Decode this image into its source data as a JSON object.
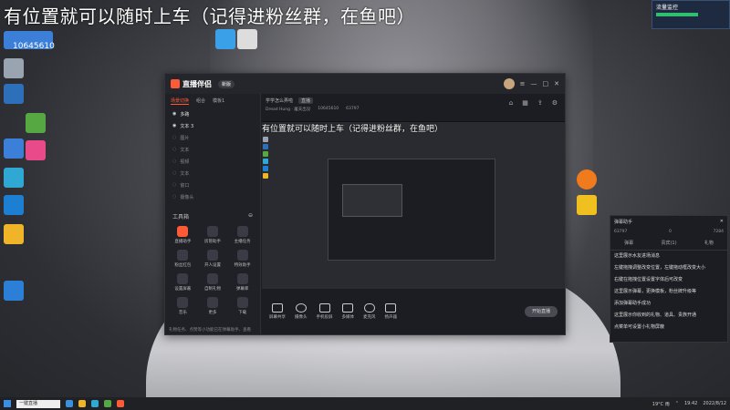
{
  "overlay": {
    "title": "有位置就可以随时上车（记得进粉丝群，在鱼吧）",
    "user_id": "10645610"
  },
  "desktop_icons": [
    {
      "name": "recycle-bin",
      "label": "回收站",
      "color": "#9aa3b0"
    },
    {
      "name": "app-2",
      "label": "",
      "color": "#2d6fb8"
    },
    {
      "name": "app-3",
      "label": "",
      "color": "#3b7fd8"
    },
    {
      "name": "app-4",
      "label": "",
      "color": "#56a843"
    },
    {
      "name": "app-5",
      "label": "",
      "color": "#2fa8d4"
    },
    {
      "name": "app-6",
      "label": "",
      "color": "#1c7fd1"
    },
    {
      "name": "app-7",
      "label": "",
      "color": "#f0b429"
    },
    {
      "name": "app-8",
      "label": "",
      "color": "#2c7fd6"
    }
  ],
  "app": {
    "name": "直播伴侣",
    "version": "新版",
    "left_tabs": [
      "场景切换",
      "组合",
      "模板1"
    ],
    "scenes": [
      "多路",
      "文本 3",
      "图片",
      "文本",
      "视频",
      "文本",
      "窗口",
      "摄像头"
    ],
    "tools_title": "工具箱",
    "tools": [
      "直播助手",
      "房管助手",
      "主播任务",
      "粉丝红包",
      "开人设置",
      "特效助手",
      "设置屏蔽",
      "自制礼物",
      "弹幕库",
      "音乐",
      "更多",
      "下载"
    ],
    "footer": "礼物任务、点赞等小功能已在弹幕助手、查看",
    "center_title": "学学怎么弄啦",
    "center_tag": "直播",
    "center_info": [
      "Dread Hung · 屠夫出没",
      "10645610",
      "63797"
    ],
    "bottom_items": [
      "屏幕共享",
      "摄像头",
      "手机投屏",
      "多媒体",
      "麦克风",
      "扬声器"
    ],
    "live_button": "开始直播"
  },
  "right_panel": {
    "title": "弹幕助手",
    "stats": [
      "63797",
      "0",
      "7284"
    ],
    "tabs": [
      "弹幕",
      "贵宾(1)",
      "礼物"
    ],
    "messages": [
      "这里展示水友进场消息",
      "左键拖拽调整改变位置，左键拖动框改变大小",
      "右键在拖拽位置设置字体后可改变",
      "这里展示弹幕，更换模板，粉丝牌升级等",
      "添加弹幕助手成功",
      "这里展示你收到的礼物、道具、贵族开通",
      "点菜单可设置小礼物屏蔽"
    ]
  },
  "taskbar": {
    "search": "一键直播",
    "tray_time": "19:42",
    "tray_date": "2022/8/12",
    "temp": "19°C 雨"
  },
  "widget": {
    "title": "流量监控"
  }
}
